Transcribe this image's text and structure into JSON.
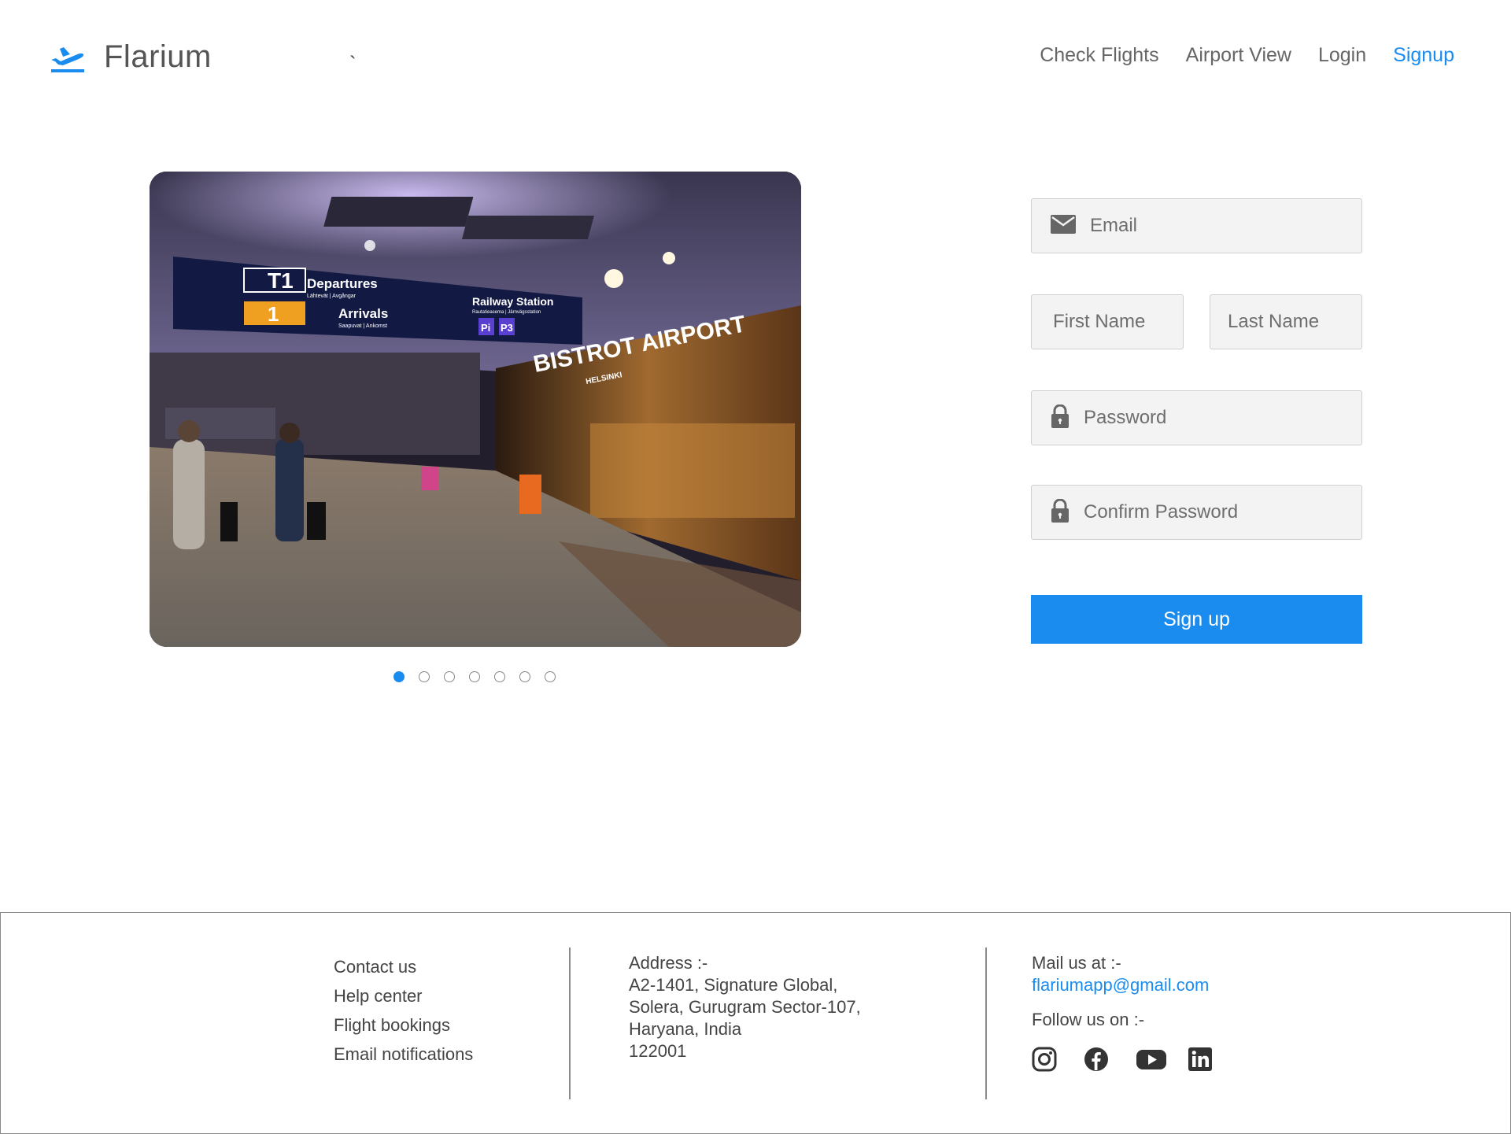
{
  "header": {
    "brand_name": "Flarium",
    "stray_mark": "`",
    "nav": [
      {
        "label": "Check Flights"
      },
      {
        "label": "Airport View"
      },
      {
        "label": "Login"
      },
      {
        "label": "Signup",
        "active": true
      }
    ]
  },
  "hero": {
    "slide_count": 7,
    "active_slide": 1,
    "sign_texts": {
      "t1": "T1",
      "departures": "Departures",
      "departures_sub": "Lähtevät | Avgångar",
      "arrivals": "Arrivals",
      "arrivals_sub": "Saapuvat | Ankomst",
      "railway": "Railway Station",
      "railway_sub": "Rautatieasema | Järnvägsstation",
      "gate": "1",
      "p1": "Pi",
      "p3": "P3",
      "bistrot": "BISTROT AIRPORT",
      "helsinki": "HELSINKI"
    }
  },
  "form": {
    "email_placeholder": "Email",
    "first_name_placeholder": "First Name",
    "last_name_placeholder": "Last Name",
    "password_placeholder": "Password",
    "confirm_password_placeholder": "Confirm Password",
    "submit_label": "Sign up"
  },
  "footer": {
    "links": [
      "Contact us",
      "Help center",
      "Flight bookings",
      "Email notifications"
    ],
    "address_title": "Address :-",
    "address_lines": [
      "A2-1401, Signature Global,",
      "Solera, Gurugram Sector-107,",
      "Haryana, India",
      "122001"
    ],
    "mail_title": "Mail us at :-",
    "mail": "flariumapp@gmail.com",
    "follow_title": "Follow us on :-",
    "social_icons": [
      "instagram-icon",
      "facebook-icon",
      "youtube-icon",
      "linkedin-icon"
    ]
  },
  "colors": {
    "accent": "#1a8cf0",
    "text": "#333333",
    "field_bg": "#f3f3f3",
    "field_border": "#cfcfcf"
  }
}
